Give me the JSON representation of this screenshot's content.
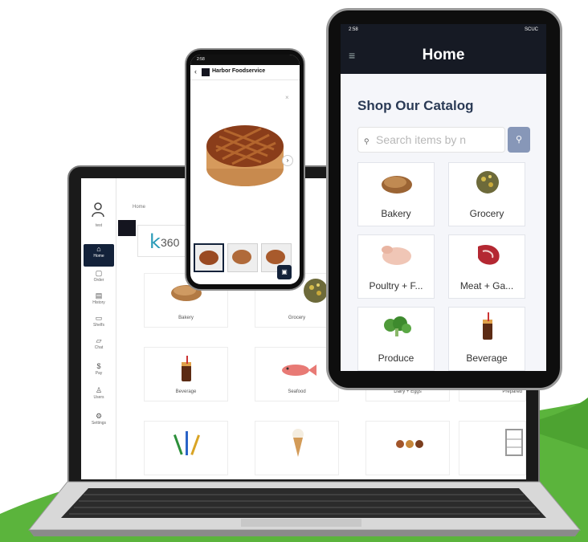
{
  "laptop": {
    "breadcrumb": "Home",
    "logo_text": "360",
    "user_name": "test",
    "nav": [
      {
        "label": "Home",
        "icon": "home-icon",
        "glyph": "⌂"
      },
      {
        "label": "Order",
        "icon": "order-icon",
        "glyph": "▢"
      },
      {
        "label": "History",
        "icon": "history-icon",
        "glyph": "▤"
      },
      {
        "label": "Shelfs",
        "icon": "shelf-icon",
        "glyph": "▭"
      },
      {
        "label": "Chat",
        "icon": "chat-icon",
        "glyph": "▱"
      },
      {
        "label": "Pay",
        "icon": "pay-icon",
        "glyph": "$"
      },
      {
        "label": "Users",
        "icon": "users-icon",
        "glyph": "♙"
      },
      {
        "label": "Settings",
        "icon": "settings-icon",
        "glyph": "⚙"
      }
    ],
    "categories": [
      {
        "label": "Bakery"
      },
      {
        "label": "Grocery"
      },
      {
        "label": "Beverage"
      },
      {
        "label": "Seafood"
      },
      {
        "label": "Dairy + Eggs"
      },
      {
        "label": "Prepared"
      }
    ]
  },
  "phone": {
    "title": "Harbor Foodservice",
    "status_time": "2:58"
  },
  "tablet": {
    "status_time": "2:58",
    "status_right": "SCUC",
    "title": "Home",
    "heading": "Shop Our Catalog",
    "search_placeholder": "Search items by n",
    "categories": [
      {
        "label": "Bakery"
      },
      {
        "label": "Grocery"
      },
      {
        "label": "Poultry + F..."
      },
      {
        "label": "Meat + Ga..."
      },
      {
        "label": "Produce"
      },
      {
        "label": "Beverage"
      }
    ]
  },
  "colors": {
    "navy": "#13223a",
    "green": "#5bb43c",
    "accent": "#8797b8"
  }
}
